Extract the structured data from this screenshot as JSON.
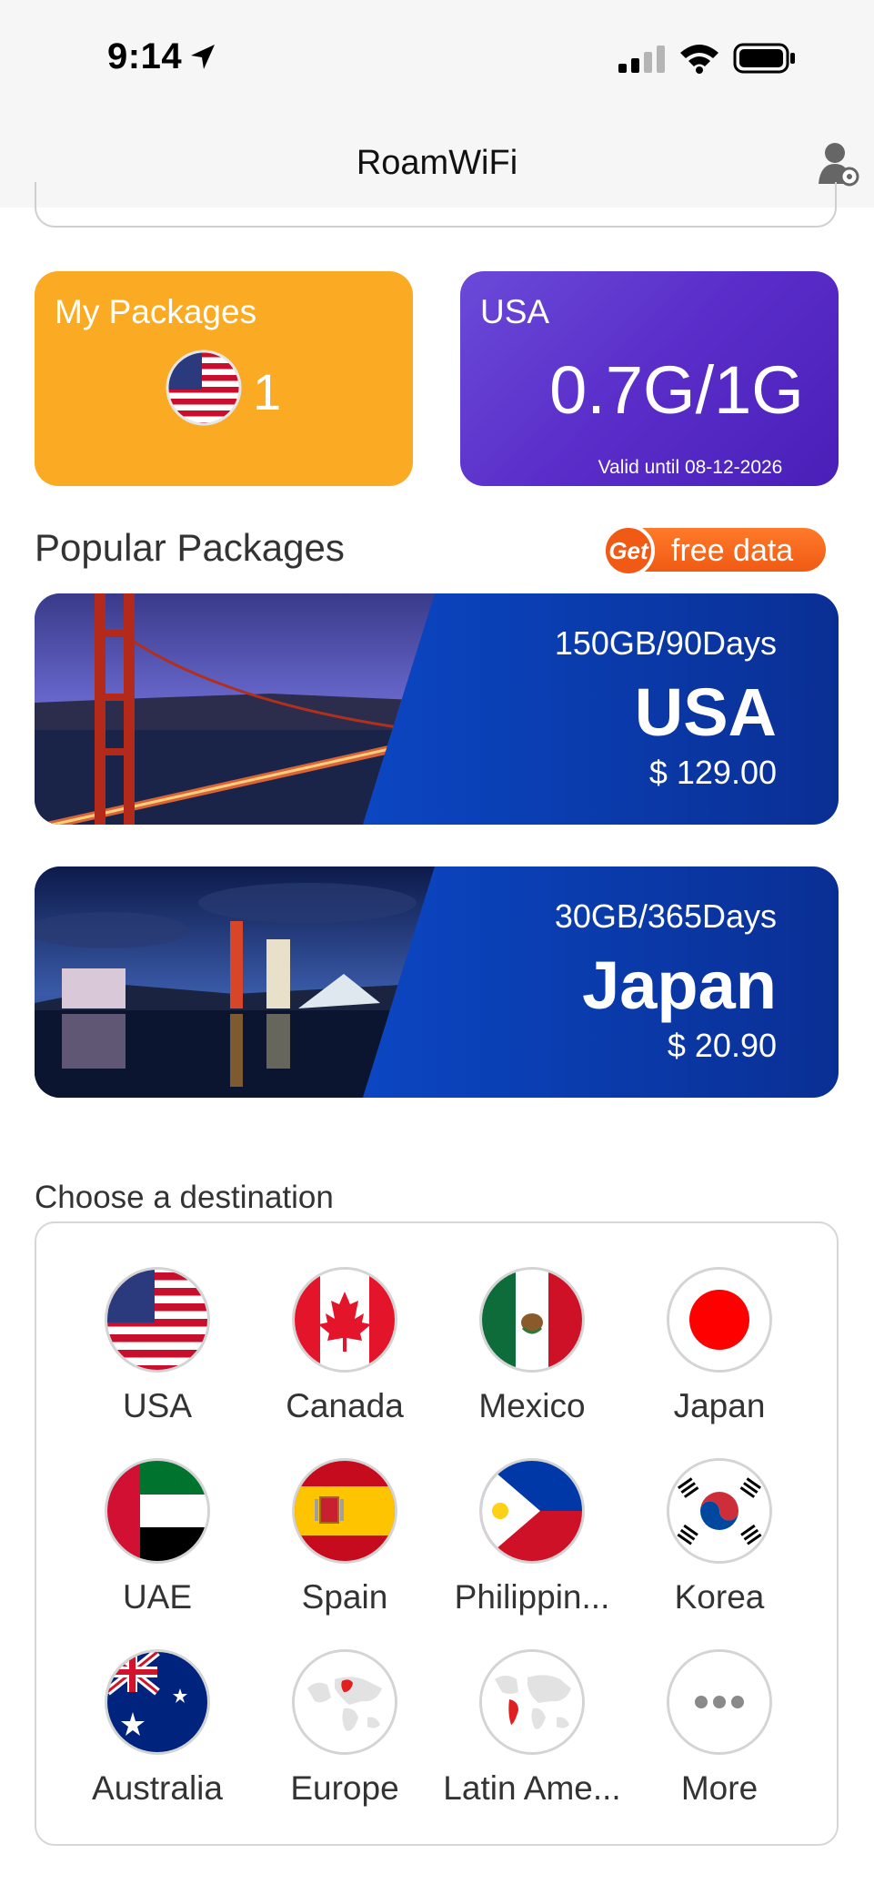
{
  "status_bar": {
    "time": "9:14"
  },
  "nav": {
    "title": "RoamWiFi"
  },
  "my_packages": {
    "label": "My Packages",
    "count": "1"
  },
  "usage_card": {
    "country": "USA",
    "usage": "0.7G/1G",
    "valid": "Valid until 08-12-2026"
  },
  "popular": {
    "title": "Popular Packages",
    "free_data": {
      "badge": "Get",
      "label": "free data"
    },
    "packages": [
      {
        "plan": "150GB/90Days",
        "country": "USA",
        "price": "$ 129.00"
      },
      {
        "plan": "30GB/365Days",
        "country": "Japan",
        "price": "$ 20.90"
      }
    ]
  },
  "destinations": {
    "title": "Choose a destination",
    "items": [
      {
        "label": "USA",
        "icon": "usa-flag-icon"
      },
      {
        "label": "Canada",
        "icon": "canada-flag-icon"
      },
      {
        "label": "Mexico",
        "icon": "mexico-flag-icon"
      },
      {
        "label": "Japan",
        "icon": "japan-flag-icon"
      },
      {
        "label": "UAE",
        "icon": "uae-flag-icon"
      },
      {
        "label": "Spain",
        "icon": "spain-flag-icon"
      },
      {
        "label": "Philippin...",
        "icon": "philippines-flag-icon"
      },
      {
        "label": "Korea",
        "icon": "korea-flag-icon"
      },
      {
        "label": "Australia",
        "icon": "australia-flag-icon"
      },
      {
        "label": "Europe",
        "icon": "europe-map-icon"
      },
      {
        "label": "Latin Ame...",
        "icon": "latin-america-map-icon"
      },
      {
        "label": "More",
        "icon": "more-dots-icon"
      }
    ]
  },
  "colors": {
    "packages_card": "#fbaa23",
    "usage_card": "#5a2dc9",
    "promo_blue": "#0a3fb4",
    "free_data_orange": "#f05a14"
  }
}
